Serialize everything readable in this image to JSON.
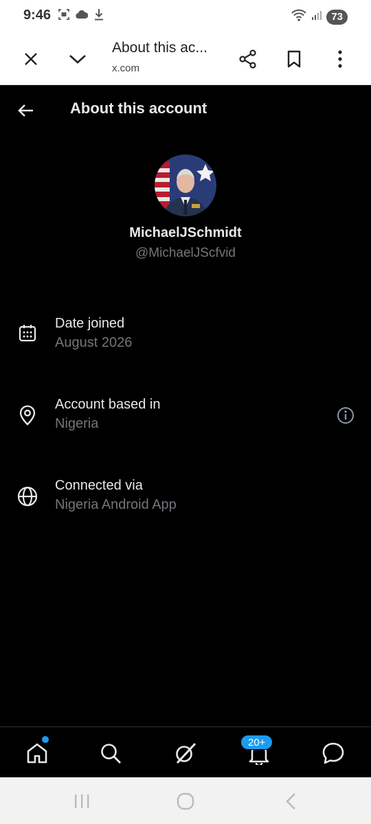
{
  "status_bar": {
    "time": "9:46",
    "battery": "73",
    "icons": [
      "screenshot-icon",
      "cloud-icon",
      "download-icon",
      "wifi-icon",
      "signal-icon"
    ]
  },
  "browser": {
    "title": "About this ac...",
    "url": "x.com",
    "icons": [
      "close-icon",
      "chevron-down-icon",
      "share-icon",
      "bookmark-icon",
      "more-vert-icon"
    ]
  },
  "header": {
    "title": "About this account"
  },
  "profile": {
    "display_name": "MichaelJSchmidt",
    "handle": "@MichaelJScfvid"
  },
  "info": [
    {
      "label": "Date joined",
      "value": "August 2026",
      "icon": "calendar-icon"
    },
    {
      "label": "Account based in",
      "value": "Nigeria",
      "icon": "location-pin-icon",
      "trailing_icon": "info-icon"
    },
    {
      "label": "Connected via",
      "value": "Nigeria Android App",
      "icon": "globe-icon"
    }
  ],
  "bottom_nav": {
    "items": [
      "home-icon",
      "search-icon",
      "grok-icon",
      "notifications-icon",
      "messages-icon"
    ],
    "notifications_badge": "20+"
  },
  "colors": {
    "background": "#000000",
    "primary_text": "#e7e9ea",
    "secondary_text": "#71767b",
    "accent": "#1d9bf0"
  }
}
